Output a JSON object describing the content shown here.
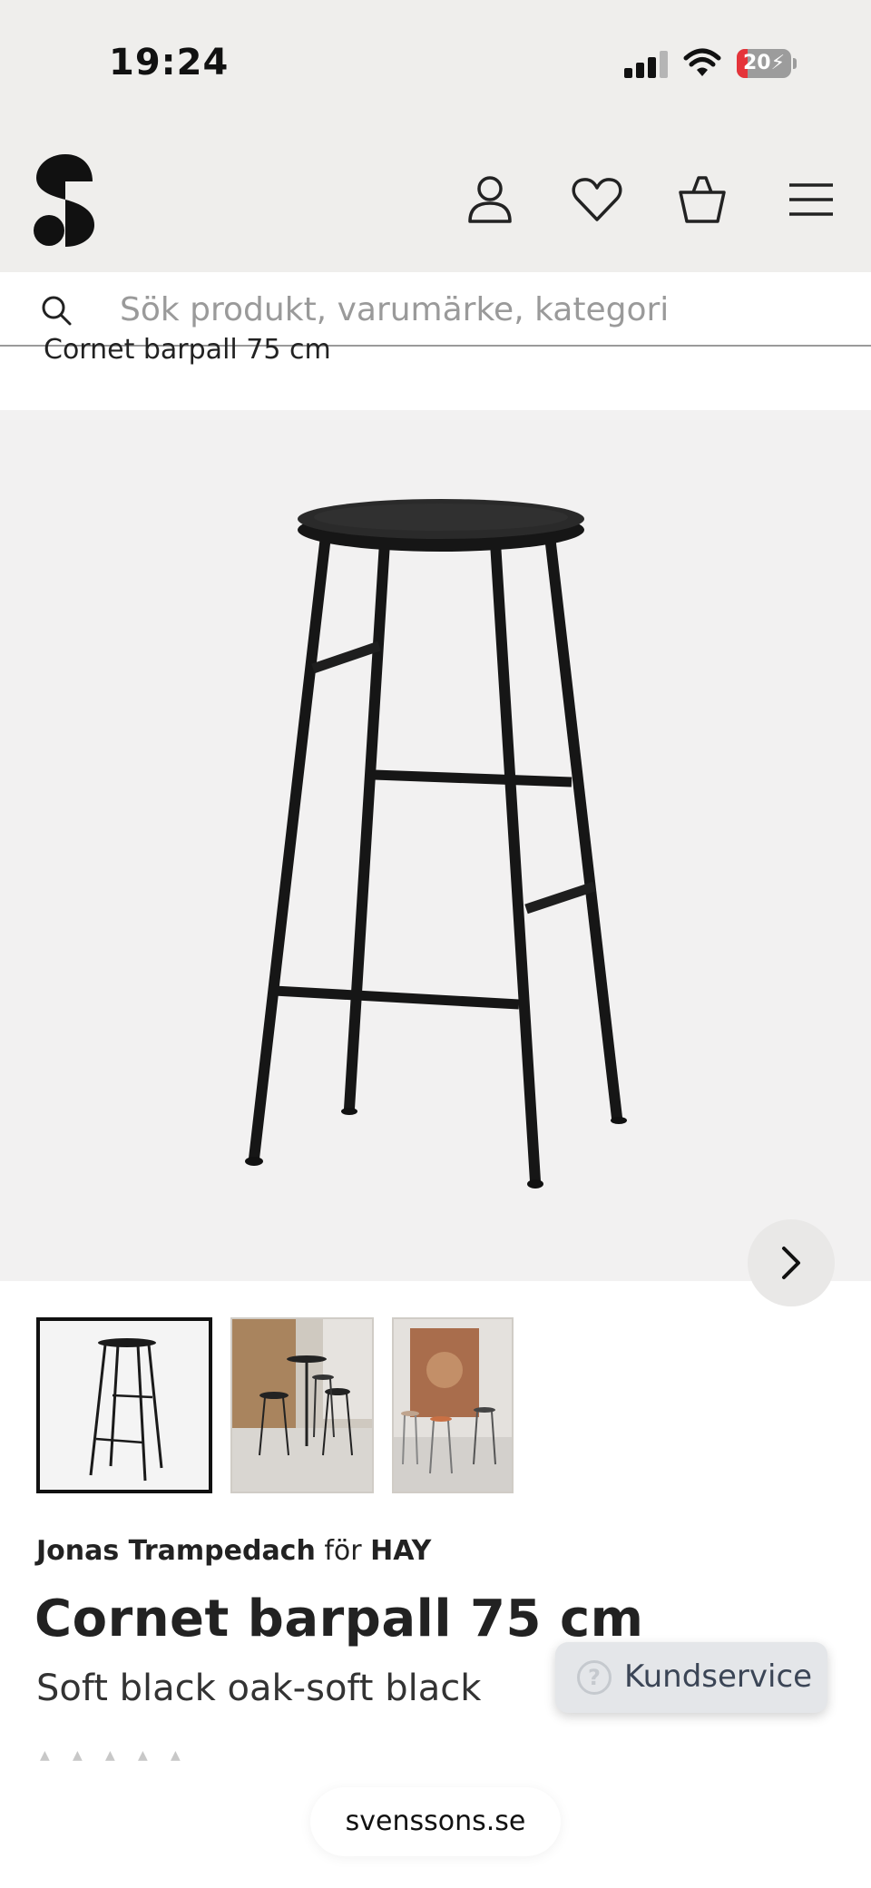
{
  "status_bar": {
    "time": "19:24",
    "battery_level": "20",
    "battery_fraction": 0.2,
    "battery_color": "#e5343a",
    "icons": [
      "cellular-signal-icon",
      "wifi-icon",
      "battery-charging-icon"
    ]
  },
  "header": {
    "logo_icon": "svenssons-s-logo",
    "icons": [
      "account-icon",
      "heart-icon",
      "shopping-basket-icon",
      "hamburger-menu-icon"
    ]
  },
  "search": {
    "placeholder": "Sök produkt, varumärke, kategori",
    "icon": "search-icon"
  },
  "breadcrumb": "Cornet barpall 75 cm",
  "gallery": {
    "next_icon": "chevron-right-icon",
    "thumbnails": [
      "stool-product-image",
      "stools-in-room-image",
      "stools-with-tapestry-image"
    ],
    "selected_index": 0
  },
  "product": {
    "designer": "Jonas Trampedach",
    "connector": "för",
    "brand": "HAY",
    "title": "Cornet barpall 75 cm",
    "variant": "Soft black oak-soft black",
    "rating_stars": 5
  },
  "kundservice": {
    "label": "Kundservice",
    "icon": "question-icon"
  },
  "url": "svenssons.se",
  "colors": {
    "header_bg": "#efeeec",
    "gallery_bg": "#f2f1f1",
    "text": "#222222",
    "kundservice_bg": "#e4e6e9",
    "kundservice_text": "#3b4556"
  }
}
